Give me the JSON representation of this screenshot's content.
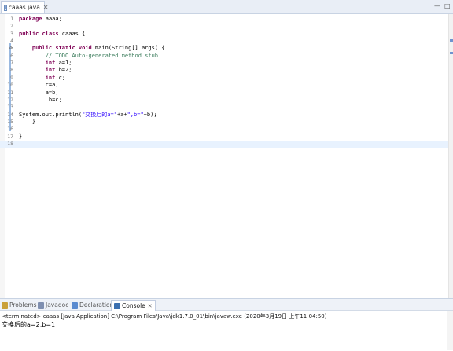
{
  "editor_tab": {
    "label": "caaas.java",
    "close": "✕",
    "icon": "java-file-icon"
  },
  "window_controls": {
    "minimize": "—",
    "maximize": "□"
  },
  "code_lines": [
    {
      "num": "1",
      "segments": [
        {
          "t": "package",
          "c": "kw"
        },
        {
          "t": " aaaa;",
          "c": ""
        }
      ]
    },
    {
      "num": "2",
      "segments": []
    },
    {
      "num": "3",
      "segments": [
        {
          "t": "public",
          "c": "kw"
        },
        {
          "t": " ",
          "c": ""
        },
        {
          "t": "class",
          "c": "kw"
        },
        {
          "t": " caaas {",
          "c": ""
        }
      ]
    },
    {
      "num": "4",
      "segments": []
    },
    {
      "num": "5",
      "segments": [
        {
          "t": "    ",
          "c": ""
        },
        {
          "t": "public",
          "c": "kw"
        },
        {
          "t": " ",
          "c": ""
        },
        {
          "t": "static",
          "c": "kw"
        },
        {
          "t": " ",
          "c": ""
        },
        {
          "t": "void",
          "c": "kw"
        },
        {
          "t": " main(String[] args) {",
          "c": ""
        }
      ]
    },
    {
      "num": "6",
      "segments": [
        {
          "t": "        // TODO Auto-generated method stub",
          "c": "cm"
        }
      ]
    },
    {
      "num": "7",
      "segments": [
        {
          "t": "        ",
          "c": ""
        },
        {
          "t": "int",
          "c": "kw"
        },
        {
          "t": " a=1;",
          "c": ""
        }
      ]
    },
    {
      "num": "8",
      "segments": [
        {
          "t": "        ",
          "c": ""
        },
        {
          "t": "int",
          "c": "kw"
        },
        {
          "t": " b=2;",
          "c": ""
        }
      ]
    },
    {
      "num": "9",
      "segments": [
        {
          "t": "        ",
          "c": ""
        },
        {
          "t": "int",
          "c": "kw"
        },
        {
          "t": " c;",
          "c": ""
        }
      ]
    },
    {
      "num": "10",
      "segments": [
        {
          "t": "        c=a;",
          "c": ""
        }
      ]
    },
    {
      "num": "11",
      "segments": [
        {
          "t": "        a=b;",
          "c": ""
        }
      ]
    },
    {
      "num": "12",
      "segments": [
        {
          "t": "         b=c;",
          "c": ""
        }
      ]
    },
    {
      "num": "13",
      "segments": []
    },
    {
      "num": "14",
      "segments": [
        {
          "t": "System.out.println(",
          "c": ""
        },
        {
          "t": "\"交换后的a=\"",
          "c": "str"
        },
        {
          "t": "+a+",
          "c": ""
        },
        {
          "t": "\",b=\"",
          "c": "str"
        },
        {
          "t": "+b);",
          "c": ""
        }
      ]
    },
    {
      "num": "15",
      "segments": [
        {
          "t": "    }",
          "c": ""
        }
      ]
    },
    {
      "num": "16",
      "segments": []
    },
    {
      "num": "17",
      "segments": [
        {
          "t": "}",
          "c": ""
        }
      ]
    },
    {
      "num": "18",
      "segments": []
    }
  ],
  "current_line": "18",
  "fold_marker": "⊖",
  "panel_tabs": [
    {
      "label": "Problems",
      "icon": "problems-icon",
      "color": "#c9a03a",
      "active": false
    },
    {
      "label": "Javadoc",
      "icon": "javadoc-icon",
      "color": "#7f8fb0",
      "active": false
    },
    {
      "label": "Declaration",
      "icon": "declaration-icon",
      "color": "#5a8bd0",
      "active": false
    },
    {
      "label": "Console",
      "icon": "console-icon",
      "color": "#3a6fb0",
      "active": true
    }
  ],
  "console": {
    "status": "<terminated> caaas [Java Application] C:\\Program Files\\Java\\jdk1.7.0_01\\bin\\javaw.exe (2020年3月19日 上午11:04:50)",
    "output": "交换后的a=2,b=1"
  }
}
